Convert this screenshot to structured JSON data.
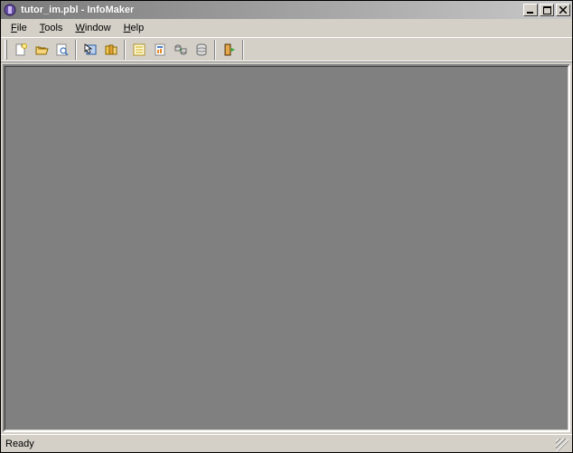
{
  "title": "tutor_im.pbl - InfoMaker",
  "menu": {
    "file": "File",
    "tools": "Tools",
    "window": "Window",
    "help": "Help"
  },
  "toolbar": {
    "new": "new",
    "open": "open",
    "preview": "preview",
    "select": "select",
    "library": "library",
    "form": "form",
    "report": "report",
    "pipeline": "pipeline",
    "database": "database",
    "exit": "exit"
  },
  "status": "Ready"
}
